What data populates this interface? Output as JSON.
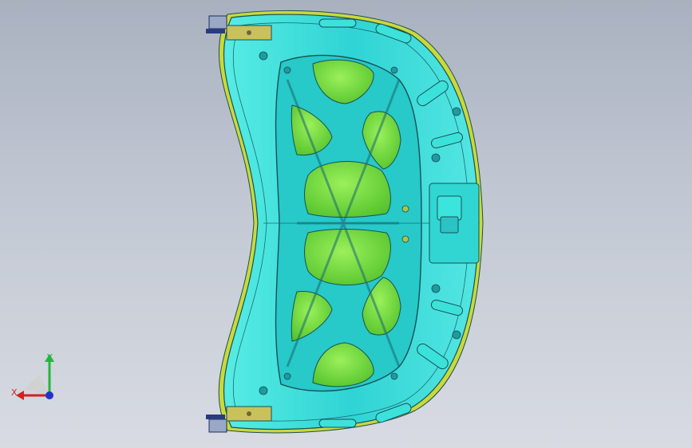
{
  "viewport": {
    "background_top": "#a9b1c0",
    "background_bottom": "#d8dbe2"
  },
  "model": {
    "description_icon": "car-hood-inner-panel",
    "colors": {
      "panel": "#3fe0d8",
      "panel_dark": "#20b8b8",
      "pocket": "#78e23c",
      "pocket_dark": "#4fb82a",
      "outline": "#1a4f55",
      "flange": "#c9d93a",
      "hinge": "#c9c25a"
    }
  },
  "triad": {
    "x_label": "X",
    "y_label": "Y",
    "x_color": "#d42020",
    "y_color": "#22b83a",
    "z_color": "#2233cc"
  }
}
